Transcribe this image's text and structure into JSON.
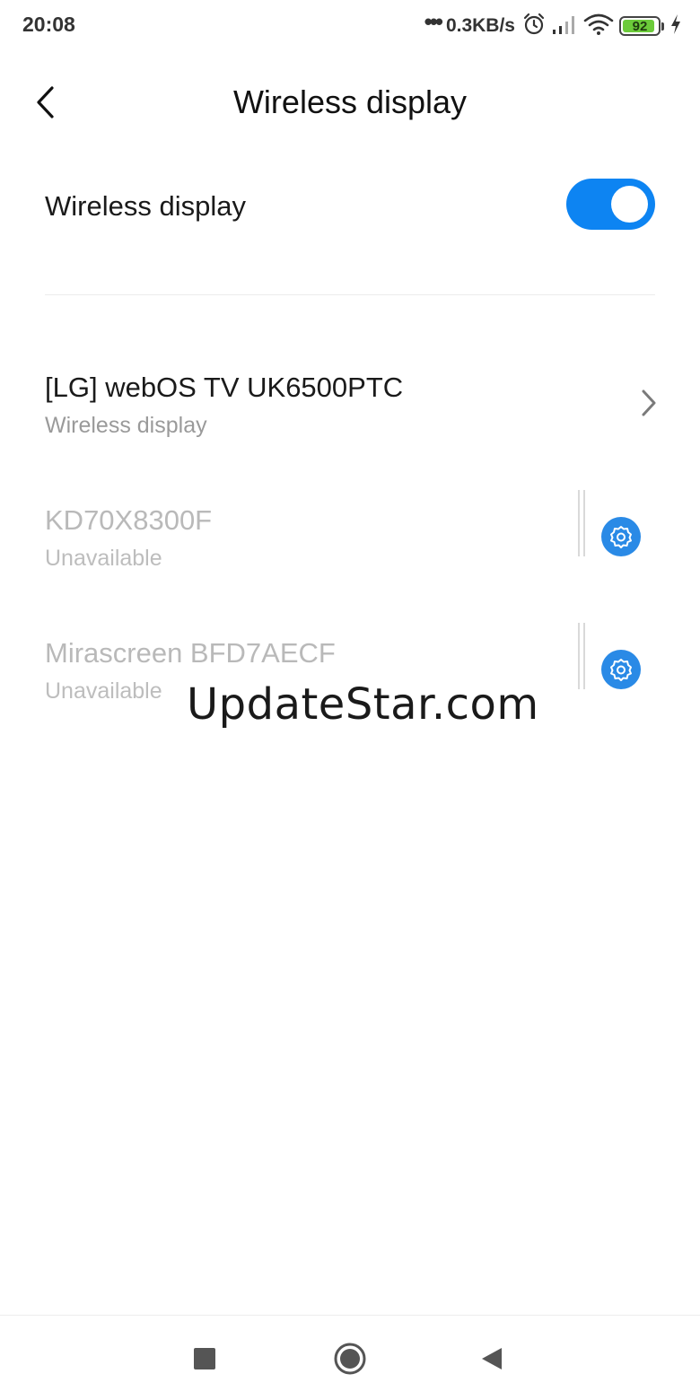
{
  "status_bar": {
    "time": "20:08",
    "dots": "•••",
    "network_speed": "0.3KB/s",
    "battery_level": "92",
    "battery_fraction": 0.92,
    "icons": [
      "alarm-icon",
      "signal-icon",
      "wifi-icon",
      "battery-icon",
      "charging-icon"
    ]
  },
  "header": {
    "title": "Wireless display",
    "back_icon": "chevron-left-icon"
  },
  "toggle": {
    "label": "Wireless display",
    "state": "on",
    "color": "#0d84f2"
  },
  "devices": [
    {
      "name": "[LG] webOS TV UK6500PTC",
      "status": "Wireless display",
      "available": true,
      "action_icon": "chevron-right-icon"
    },
    {
      "name": "KD70X8300F",
      "status": "Unavailable",
      "available": false,
      "action_icon": "settings-icon"
    },
    {
      "name": "Mirascreen BFD7AECF",
      "status": "Unavailable",
      "available": false,
      "action_icon": "settings-icon"
    }
  ],
  "watermark": "UpdateStar.com",
  "nav_bar": {
    "buttons": [
      "recents-icon",
      "home-icon",
      "back-icon"
    ]
  }
}
